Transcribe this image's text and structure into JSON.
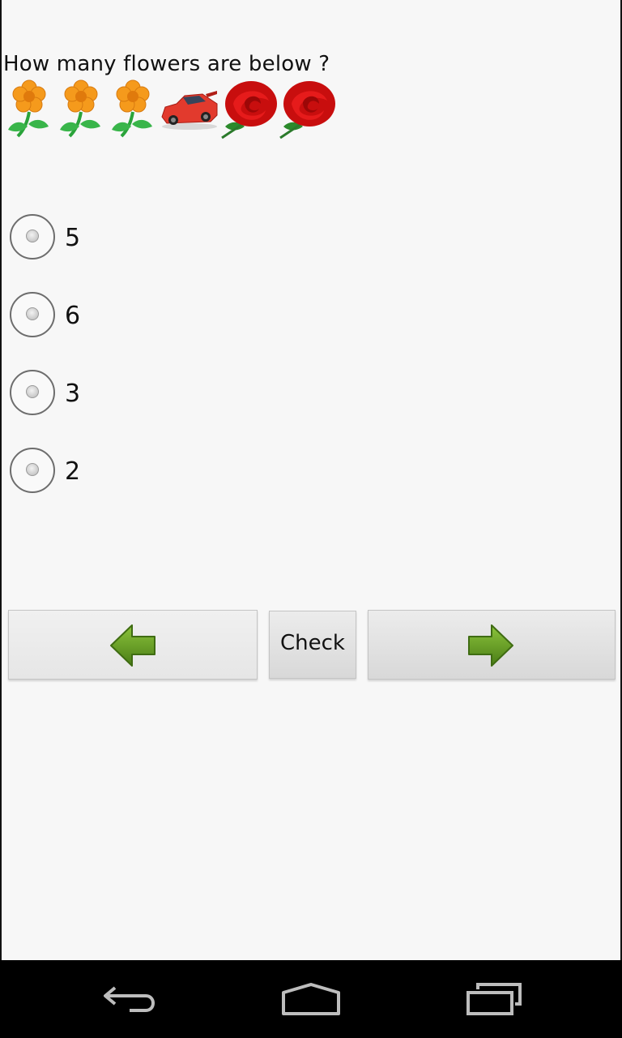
{
  "question": "How many flowers are below ?",
  "pictures": [
    "flower-icon",
    "flower-icon",
    "flower-icon",
    "car-icon",
    "rose-icon",
    "rose-icon"
  ],
  "options": [
    {
      "label": "5",
      "selected": false
    },
    {
      "label": "6",
      "selected": false
    },
    {
      "label": "3",
      "selected": false
    },
    {
      "label": "2",
      "selected": false
    }
  ],
  "buttons": {
    "prev_icon": "left-arrow-icon",
    "check_label": "Check",
    "next_icon": "right-arrow-icon"
  },
  "navbar": [
    "back-icon",
    "home-icon",
    "recent-apps-icon"
  ],
  "colors": {
    "background": "#f7f7f7",
    "arrow_green": "#5e9a1e",
    "flower_orange": "#f59a1c",
    "rose_red": "#d40f0f",
    "car_red": "#e23a2d"
  }
}
